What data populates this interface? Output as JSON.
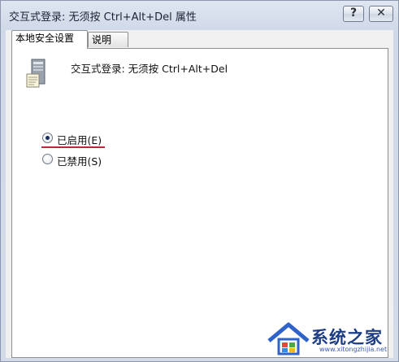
{
  "window": {
    "title": "交互式登录: 无须按 Ctrl+Alt+Del 属性",
    "help_label": "?",
    "close_label": "✕"
  },
  "tabs": [
    {
      "label": "本地安全设置",
      "active": true
    },
    {
      "label": "说明",
      "active": false
    }
  ],
  "policy": {
    "icon": "server-computer-icon",
    "name": "交互式登录: 无须按 Ctrl+Alt+Del"
  },
  "options": {
    "enabled_label": "已启用(E)",
    "disabled_label": "已禁用(S)",
    "selected": "enabled"
  },
  "watermark": {
    "text": "系统之家",
    "url": "www.xitongzhijia.net"
  },
  "colors": {
    "underline": "#c2253a",
    "watermark_blue": "#1d3e85"
  }
}
